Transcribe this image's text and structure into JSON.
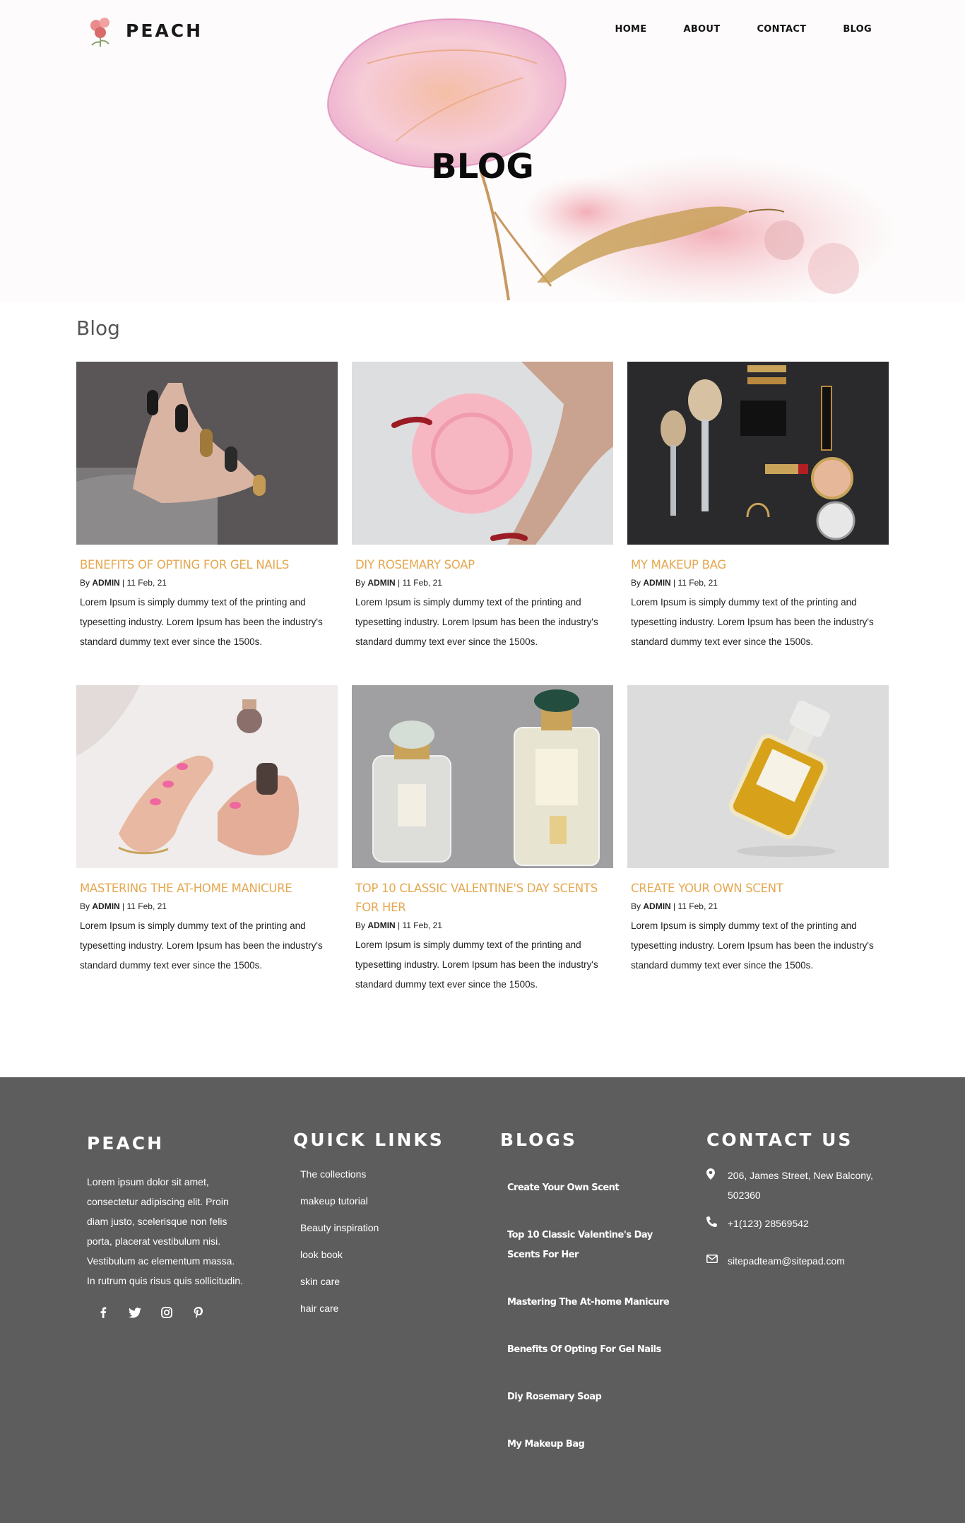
{
  "brand": {
    "name": "PEACH"
  },
  "nav": {
    "items": [
      "HOME",
      "ABOUT",
      "CONTACT",
      "BLOG"
    ]
  },
  "hero": {
    "title": "BLOG"
  },
  "section": {
    "title": "Blog"
  },
  "posts": [
    {
      "title": "BENEFITS OF OPTING FOR GEL NAILS",
      "by": "By",
      "author": "ADMIN",
      "date": "| 11 Feb, 21",
      "excerpt": "Lorem Ipsum is simply dummy text of the printing and typesetting industry. Lorem Ipsum has been the industry's standard dummy text ever since the 1500s."
    },
    {
      "title": "DIY ROSEMARY SOAP",
      "by": "By",
      "author": "ADMIN",
      "date": "| 11 Feb, 21",
      "excerpt": "Lorem Ipsum is simply dummy text of the printing and typesetting industry. Lorem Ipsum has been the industry's standard dummy text ever since the 1500s."
    },
    {
      "title": "MY MAKEUP BAG",
      "by": "By",
      "author": "ADMIN",
      "date": "| 11 Feb, 21",
      "excerpt": "Lorem Ipsum is simply dummy text of the printing and typesetting industry. Lorem Ipsum has been the industry's standard dummy text ever since the 1500s."
    },
    {
      "title": "MASTERING THE AT-HOME MANICURE",
      "by": "By",
      "author": "ADMIN",
      "date": "| 11 Feb, 21",
      "excerpt": "Lorem Ipsum is simply dummy text of the printing and typesetting industry. Lorem Ipsum has been the industry's standard dummy text ever since the 1500s."
    },
    {
      "title": "TOP 10 CLASSIC VALENTINE'S DAY SCENTS FOR HER",
      "by": "By",
      "author": "ADMIN",
      "date": "| 11 Feb, 21",
      "excerpt": "Lorem Ipsum is simply dummy text of the printing and typesetting industry. Lorem Ipsum has been the industry's standard dummy text ever since the 1500s."
    },
    {
      "title": "CREATE YOUR OWN SCENT",
      "by": "By",
      "author": "ADMIN",
      "date": "| 11 Feb, 21",
      "excerpt": "Lorem Ipsum is simply dummy text of the printing and typesetting industry. Lorem Ipsum has been the industry's standard dummy text ever since the 1500s."
    }
  ],
  "footer": {
    "about": {
      "title": "PEACH",
      "text": "Lorem ipsum dolor sit amet, consectetur adipiscing elit. Proin diam justo, scelerisque non felis porta, placerat vestibulum nisi. Vestibulum ac elementum massa. In rutrum quis risus quis sollicitudin.",
      "social": [
        "facebook-icon",
        "twitter-icon",
        "instagram-icon",
        "pinterest-icon"
      ]
    },
    "quick_links": {
      "title": "QUICK LINKS",
      "items": [
        "The collections",
        "makeup tutorial",
        "Beauty inspiration",
        "look book",
        "skin care",
        "hair care"
      ]
    },
    "blogs": {
      "title": "BLOGS",
      "items": [
        "Create Your Own Scent",
        "Top 10 Classic Valentine's Day Scents For Her",
        "Mastering The At-home Manicure",
        "Benefits Of Opting For Gel Nails",
        "Diy Rosemary Soap",
        "My Makeup Bag"
      ]
    },
    "contact": {
      "title": "CONTACT US",
      "address": "206, James Street, New Balcony, 502360",
      "phone": "+1(123) 28569542",
      "email": "sitepadteam@sitepad.com"
    }
  },
  "colors": {
    "accent": "#e5a851",
    "footer_bg": "#5d5d5d",
    "text": "#222222"
  }
}
